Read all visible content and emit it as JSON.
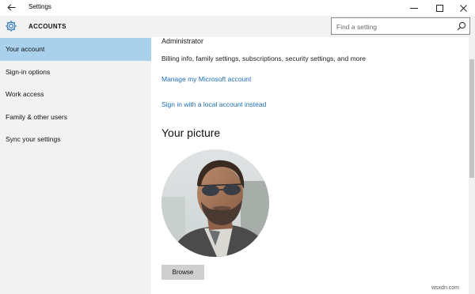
{
  "window": {
    "title": "Settings",
    "back_icon": "back-arrow-icon",
    "minimize_icon": "minimize-icon",
    "maximize_icon": "maximize-icon",
    "close_icon": "close-icon"
  },
  "sidebar": {
    "section_icon": "gear-icon",
    "section_title": "ACCOUNTS",
    "items": [
      {
        "label": "Your account",
        "active": true
      },
      {
        "label": "Sign-in options",
        "active": false
      },
      {
        "label": "Work access",
        "active": false
      },
      {
        "label": "Family & other users",
        "active": false
      },
      {
        "label": "Sync your settings",
        "active": false
      }
    ]
  },
  "search": {
    "placeholder": "Find a setting",
    "icon": "search-icon"
  },
  "content": {
    "account_type": "Administrator",
    "billing_text": "Billing info, family settings, subscriptions, security settings, and more",
    "manage_link": "Manage my Microsoft account",
    "local_link": "Sign in with a local account instead",
    "picture_heading": "Your picture",
    "browse_label": "Browse"
  },
  "watermark": "wsxdn.com",
  "colors": {
    "accent": "#1c6fc1",
    "selected_bg": "#a9d1ec",
    "sidebar_bg": "#f2f2f2",
    "button_bg": "#cfcfcf"
  }
}
